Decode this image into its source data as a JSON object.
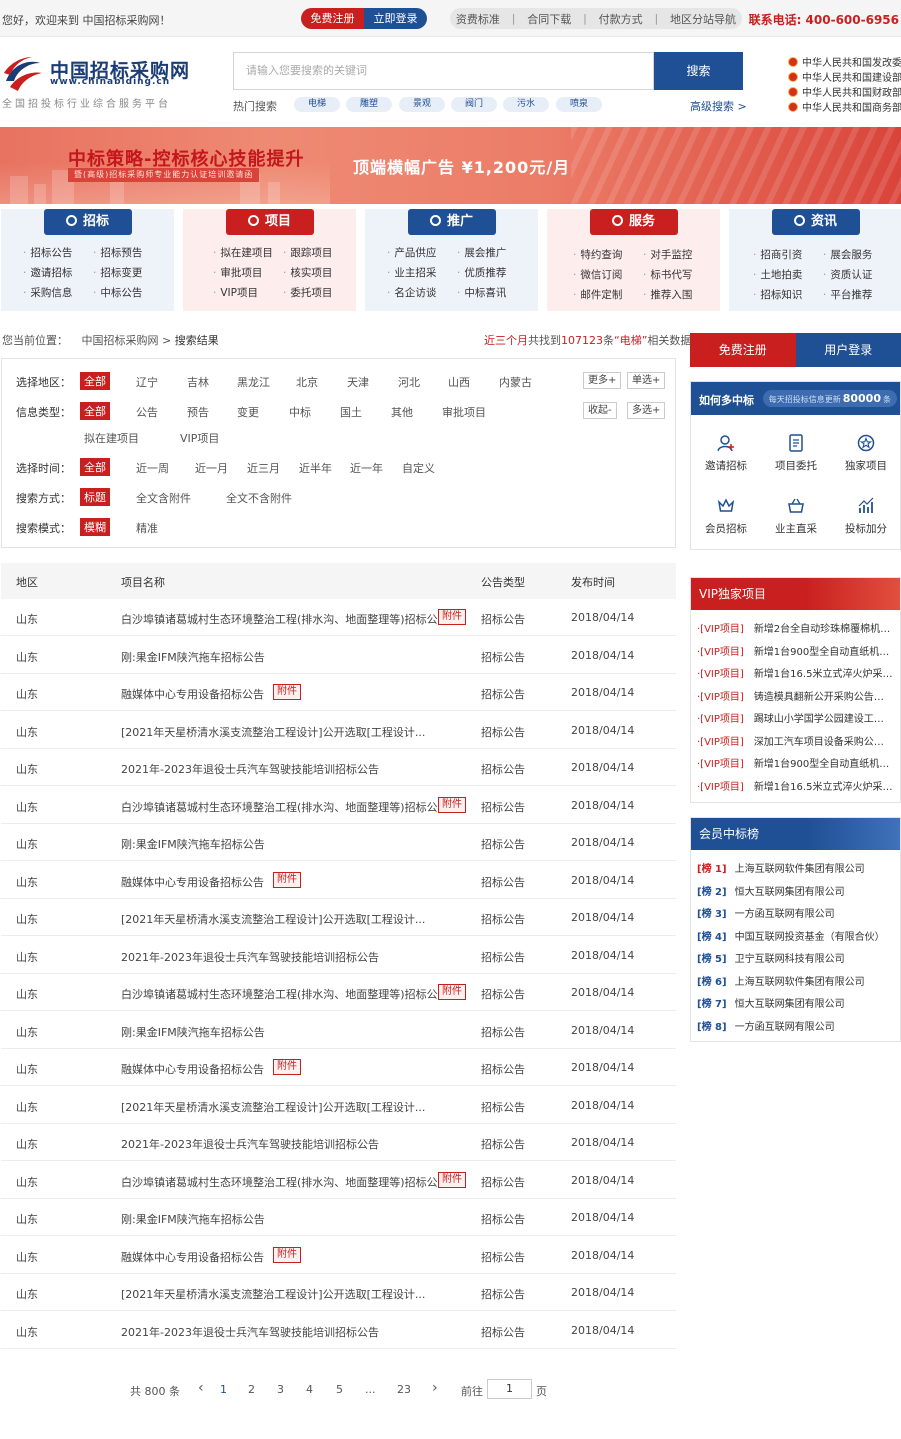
{
  "topbar": {
    "welcome": "您好，欢迎来到 中国招标采购网！",
    "register": "免费注册",
    "login": "立即登录",
    "links": [
      "资费标准",
      "合同下载",
      "付款方式",
      "地区分站导航"
    ],
    "phone": "联系电话: 400-600-6956"
  },
  "logo": {
    "name": "中国招标采购网",
    "url": "www.chinabiding.cn",
    "slogan": "全国招投标行业综合服务平台"
  },
  "search": {
    "placeholder": "请输入您要搜索的关键词",
    "button": "搜索",
    "hot_label": "热门搜索",
    "hot_tags": [
      "电梯",
      "雕塑",
      "景观",
      "阀门",
      "污水",
      "喷泉"
    ],
    "advanced": "高级搜索 >"
  },
  "gov_links": [
    "中华人民共和国发改委",
    "中华人民共和国建设部",
    "中华人民共和国财政部",
    "中华人民共和国商务部"
  ],
  "banner": {
    "title": "中标策略-控标核心技能提升",
    "sub": "暨(高级)招标采购师专业能力认证培训邀请函",
    "ad": "顶端横幅广告  ¥1,200元/月"
  },
  "categories": [
    {
      "title": "招标",
      "items": [
        "招标公告",
        "招标预告",
        "邀请招标",
        "招标变更",
        "采购信息",
        "中标公告"
      ]
    },
    {
      "title": "项目",
      "items": [
        "拟在建项目",
        "跟踪项目",
        "审批项目",
        "核实项目",
        "VIP项目",
        "委托项目"
      ]
    },
    {
      "title": "推广",
      "items": [
        "产品供应",
        "展会推广",
        "业主招采",
        "优质推荐",
        "名企访谈",
        "中标喜讯"
      ]
    },
    {
      "title": "服务",
      "items": [
        "特约查询",
        "对手监控",
        "微信订阅",
        "标书代写",
        "邮件定制",
        "推荐入围"
      ]
    },
    {
      "title": "资讯",
      "items": [
        "招商引资",
        "展会服务",
        "土地拍卖",
        "资质认证",
        "招标知识",
        "平台推荐"
      ]
    }
  ],
  "breadcrumb": {
    "prefix": "您当前位置：",
    "home": "中国招标采购网",
    "sep": " > ",
    "current": "搜索结果"
  },
  "summary": {
    "period": "近三个月",
    "text1": "共找到",
    "count": "107123",
    "text2": "条",
    "keyword": "“电梯”",
    "text3": "相关数据"
  },
  "filters": {
    "region": {
      "label": "选择地区：",
      "options": [
        "全部",
        "辽宁",
        "吉林",
        "黑龙江",
        "北京",
        "天津",
        "河北",
        "山西",
        "内蒙古"
      ],
      "more": "更多+",
      "single": "单选+"
    },
    "type": {
      "label": "信息类型：",
      "options": [
        "全部",
        "公告",
        "预告",
        "变更",
        "中标",
        "国土",
        "其他",
        "审批项目"
      ],
      "options2": [
        "拟在建项目",
        "VIP项目"
      ],
      "collapse": "收起-",
      "multi": "多选+"
    },
    "time": {
      "label": "选择时间：",
      "options": [
        "全部",
        "近一周",
        "近一月",
        "近三月",
        "近半年",
        "近一年",
        "自定义"
      ]
    },
    "mode": {
      "label": "搜索方式：",
      "options": [
        "标题",
        "全文含附件",
        "全文不含附件"
      ]
    },
    "pattern": {
      "label": "搜索模式：",
      "options": [
        "模糊",
        "精准"
      ]
    }
  },
  "table": {
    "headers": [
      "地区",
      "项目名称",
      "公告类型",
      "发布时间"
    ],
    "attachment_label": "附件",
    "rows": [
      {
        "region": "山东",
        "name": "白沙埠镇诸葛城村生态环境整治工程(排水沟、地面整理等)招标公...",
        "att": true,
        "type": "招标公告",
        "date": "2018/04/14"
      },
      {
        "region": "山东",
        "name": "刚:果金IFM陕汽拖车招标公告",
        "att": false,
        "type": "招标公告",
        "date": "2018/04/14"
      },
      {
        "region": "山东",
        "name": "融媒体中心专用设备招标公告",
        "att": true,
        "type": "招标公告",
        "date": "2018/04/14"
      },
      {
        "region": "山东",
        "name": "[2021年天星桥清水溪支流整治工程设计]公开选取[工程设计...",
        "att": false,
        "type": "招标公告",
        "date": "2018/04/14"
      },
      {
        "region": "山东",
        "name": "2021年-2023年退役士兵汽车驾驶技能培训招标公告",
        "att": false,
        "type": "招标公告",
        "date": "2018/04/14"
      },
      {
        "region": "山东",
        "name": "白沙埠镇诸葛城村生态环境整治工程(排水沟、地面整理等)招标公...",
        "att": true,
        "type": "招标公告",
        "date": "2018/04/14"
      },
      {
        "region": "山东",
        "name": "刚:果金IFM陕汽拖车招标公告",
        "att": false,
        "type": "招标公告",
        "date": "2018/04/14"
      },
      {
        "region": "山东",
        "name": "融媒体中心专用设备招标公告",
        "att": true,
        "type": "招标公告",
        "date": "2018/04/14"
      },
      {
        "region": "山东",
        "name": "[2021年天星桥清水溪支流整治工程设计]公开选取[工程设计...",
        "att": false,
        "type": "招标公告",
        "date": "2018/04/14"
      },
      {
        "region": "山东",
        "name": "2021年-2023年退役士兵汽车驾驶技能培训招标公告",
        "att": false,
        "type": "招标公告",
        "date": "2018/04/14"
      },
      {
        "region": "山东",
        "name": "白沙埠镇诸葛城村生态环境整治工程(排水沟、地面整理等)招标公...",
        "att": true,
        "type": "招标公告",
        "date": "2018/04/14"
      },
      {
        "region": "山东",
        "name": "刚:果金IFM陕汽拖车招标公告",
        "att": false,
        "type": "招标公告",
        "date": "2018/04/14"
      },
      {
        "region": "山东",
        "name": "融媒体中心专用设备招标公告",
        "att": true,
        "type": "招标公告",
        "date": "2018/04/14"
      },
      {
        "region": "山东",
        "name": "[2021年天星桥清水溪支流整治工程设计]公开选取[工程设计...",
        "att": false,
        "type": "招标公告",
        "date": "2018/04/14"
      },
      {
        "region": "山东",
        "name": "2021年-2023年退役士兵汽车驾驶技能培训招标公告",
        "att": false,
        "type": "招标公告",
        "date": "2018/04/14"
      },
      {
        "region": "山东",
        "name": "白沙埠镇诸葛城村生态环境整治工程(排水沟、地面整理等)招标公...",
        "att": true,
        "type": "招标公告",
        "date": "2018/04/14"
      },
      {
        "region": "山东",
        "name": "刚:果金IFM陕汽拖车招标公告",
        "att": false,
        "type": "招标公告",
        "date": "2018/04/14"
      },
      {
        "region": "山东",
        "name": "融媒体中心专用设备招标公告",
        "att": true,
        "type": "招标公告",
        "date": "2018/04/14"
      },
      {
        "region": "山东",
        "name": "[2021年天星桥清水溪支流整治工程设计]公开选取[工程设计...",
        "att": false,
        "type": "招标公告",
        "date": "2018/04/14"
      },
      {
        "region": "山东",
        "name": "2021年-2023年退役士兵汽车驾驶技能培训招标公告",
        "att": false,
        "type": "招标公告",
        "date": "2018/04/14"
      }
    ]
  },
  "pagination": {
    "total": "共 800 条",
    "prev": "‹",
    "pages": [
      "1",
      "2",
      "3",
      "4",
      "5",
      "...",
      "23"
    ],
    "current": "1",
    "next": "›",
    "goto": "前往",
    "goto_value": "1",
    "page_unit": "页"
  },
  "sidebar": {
    "register": "免费注册",
    "login": "用户登录",
    "howto": {
      "title": "如何多中标",
      "pill_prefix": "每天招投标信息更新",
      "pill_count": "80000",
      "pill_suffix": "条",
      "items": [
        {
          "label": "邀请招标",
          "icon": "user-add-icon"
        },
        {
          "label": "项目委托",
          "icon": "document-icon"
        },
        {
          "label": "独家项目",
          "icon": "star-badge-icon"
        },
        {
          "label": "会员招标",
          "icon": "crown-icon"
        },
        {
          "label": "业主直采",
          "icon": "basket-icon"
        },
        {
          "label": "投标加分",
          "icon": "chart-up-icon"
        }
      ]
    },
    "vip": {
      "title": "VIP独家项目",
      "tag": "·[VIP项目]",
      "items": [
        "新增2台全自动珍珠棉覆棉机采...",
        "新增1台900型全自动直纸机采...",
        "新增1台16.5米立式淬火炉采购...",
        "铸造模具翻新公开采购公告（8...",
        "踢球山小学国学公园建设工程...",
        "深加工汽车项目设备采购公告...",
        "新增1台900型全自动直纸机采...",
        "新增1台16.5米立式淬火炉采购..."
      ]
    },
    "rank": {
      "title": "会员中标榜",
      "items": [
        {
          "rank": "[榜 1]",
          "name": "上海互联网软件集团有限公司"
        },
        {
          "rank": "[榜 2]",
          "name": "恒大互联网集团有限公司"
        },
        {
          "rank": "[榜 3]",
          "name": "一方函互联网有限公司"
        },
        {
          "rank": "[榜 4]",
          "name": "中国互联网投资基金（有限合伙）"
        },
        {
          "rank": "[榜 5]",
          "name": "卫宁互联网科技有限公司"
        },
        {
          "rank": "[榜 6]",
          "name": "上海互联网软件集团有限公司"
        },
        {
          "rank": "[榜 7]",
          "name": "恒大互联网集团有限公司"
        },
        {
          "rank": "[榜 8]",
          "name": "一方函互联网有限公司"
        }
      ]
    }
  }
}
